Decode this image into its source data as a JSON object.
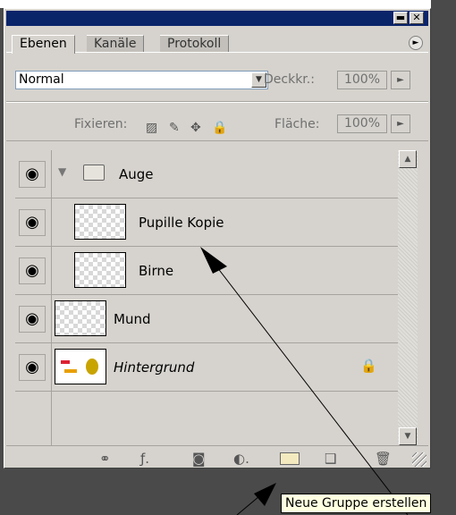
{
  "panel": {
    "tabs": [
      {
        "label": "Ebenen",
        "active": true
      },
      {
        "label": "Kanäle",
        "active": false
      },
      {
        "label": "Protokoll",
        "active": false
      }
    ],
    "title_buttons": {
      "minimize": "▬",
      "close": "✕"
    },
    "menu_icon": "►"
  },
  "blend": {
    "mode": "Normal",
    "opacity_label": "Deckkr.:",
    "opacity_value": "100%",
    "lock_label": "Fixieren:",
    "fill_label": "Fläche:",
    "fill_value": "100%"
  },
  "layers": [
    {
      "name": "Auge",
      "type": "group",
      "expanded": true,
      "visible": true,
      "indent": 0
    },
    {
      "name": "Pupille Kopie",
      "type": "layer",
      "visible": true,
      "indent": 1
    },
    {
      "name": "Birne",
      "type": "layer",
      "visible": true,
      "indent": 1
    },
    {
      "name": "Mund",
      "type": "layer",
      "visible": true,
      "indent": 0
    },
    {
      "name": "Hintergrund",
      "type": "background",
      "visible": true,
      "indent": 0,
      "locked": true
    }
  ],
  "tooltip": {
    "text": "Neue Gruppe erstellen"
  },
  "colors": {
    "titlebar": "#0a246a",
    "panel": "#d6d3ce",
    "tooltip_bg": "#ffffe1"
  }
}
